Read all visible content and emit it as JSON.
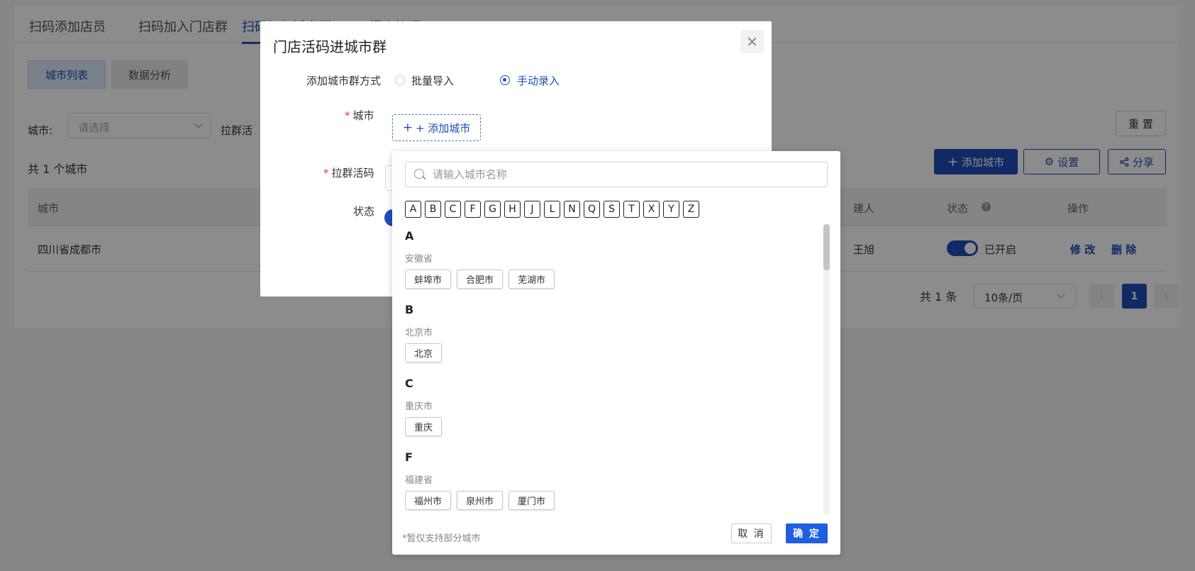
{
  "tabs": [
    "扫码添加店员",
    "扫码加入门店群",
    "扫码加入城市群",
    "门店管理"
  ],
  "segments": [
    "城市列表",
    "数据分析"
  ],
  "filters": {
    "city_label": "城市:",
    "city_placeholder": "请选择",
    "group_label": "拉群活"
  },
  "toolbar": {
    "reset": "重 置",
    "add_city": "添加城市",
    "settings": "设置",
    "share": "分享"
  },
  "list_count": "共 1 个城市",
  "table": {
    "headers": {
      "city": "城市",
      "owner": "建人",
      "status": "状态",
      "action": "操作"
    },
    "row": {
      "city": "四川省成都市",
      "owner": "王旭",
      "status": "已开启",
      "edit": "修 改",
      "delete": "删 除"
    }
  },
  "pagination": {
    "total": "共 1 条",
    "page_size": "10条/页",
    "current": "1"
  },
  "modal": {
    "title": "门店活码进城市群",
    "mode_label": "添加城市群方式",
    "mode_options": [
      "批量导入",
      "手动录入"
    ],
    "city_label": "城市",
    "add_city_button": "+ 添加城市",
    "group_code_label": "拉群活码",
    "status_label": "状态"
  },
  "picker": {
    "search_placeholder": "请输入城市名称",
    "letters": [
      "A",
      "B",
      "C",
      "F",
      "G",
      "H",
      "J",
      "L",
      "N",
      "Q",
      "S",
      "T",
      "X",
      "Y",
      "Z"
    ],
    "groups": [
      {
        "letter": "A",
        "province": "安徽省",
        "cities": [
          "蚌埠市",
          "合肥市",
          "芜湖市"
        ]
      },
      {
        "letter": "B",
        "province": "北京市",
        "cities": [
          "北京"
        ]
      },
      {
        "letter": "C",
        "province": "重庆市",
        "cities": [
          "重庆"
        ]
      },
      {
        "letter": "F",
        "province": "福建省",
        "cities": [
          "福州市",
          "泉州市",
          "厦门市"
        ]
      }
    ],
    "note": "*暂仅支持部分城市",
    "cancel": "取 消",
    "ok": "确 定"
  }
}
